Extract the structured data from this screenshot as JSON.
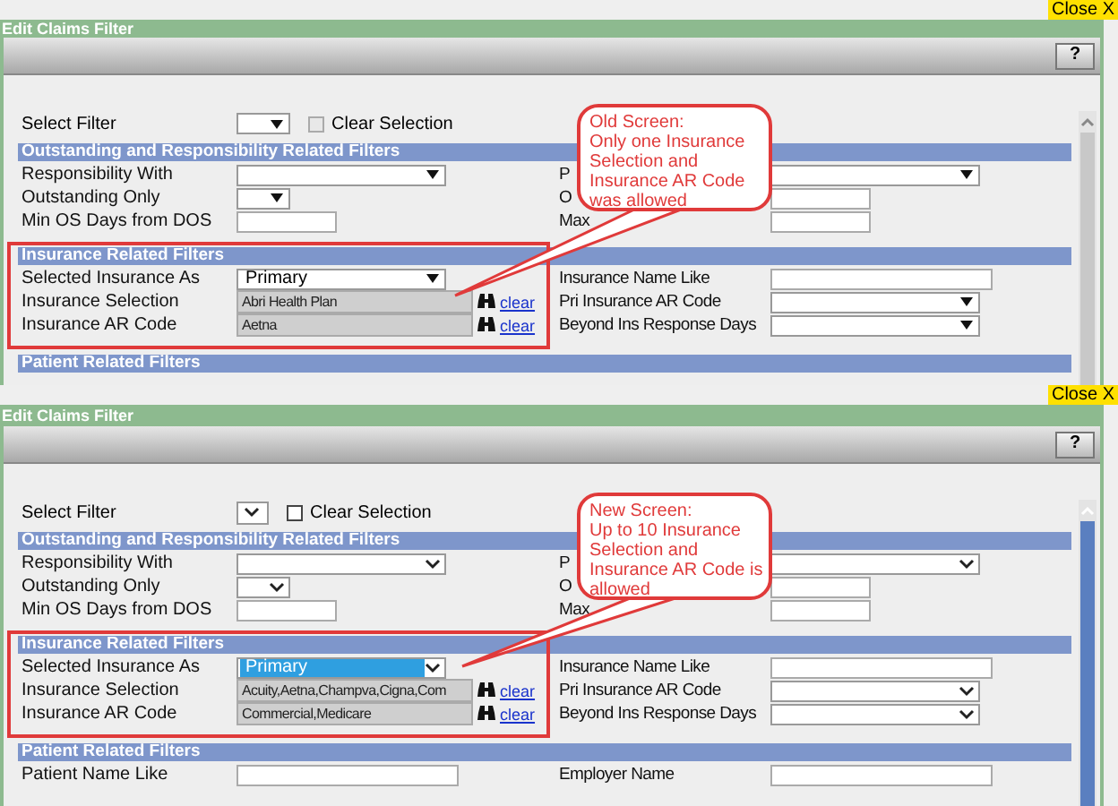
{
  "screens": [
    {
      "kind": "classic",
      "close": "Close X",
      "title": "Edit Claims Filter",
      "help": "?",
      "select_filter": {
        "label": "Select Filter",
        "checkbox": {
          "label": "Clear Selection",
          "checked": false
        }
      },
      "sections": [
        {
          "title": "Outstanding and Responsibility Related Filters",
          "rows": [
            {
              "left": {
                "label": "Responsibility With",
                "kind": "dropdown"
              },
              "right": {
                "label": "P",
                "kind": "dropdown"
              }
            },
            {
              "left": {
                "label": "Outstanding Only",
                "kind": "short-dropdown"
              },
              "right": {
                "label": "O",
                "kind": "short-input"
              }
            },
            {
              "left": {
                "label": "Min OS Days from DOS",
                "kind": "short-input"
              },
              "right": {
                "label": "Max",
                "kind": "short-input"
              }
            }
          ]
        },
        {
          "title": "Insurance Related Filters",
          "framed": true,
          "rows": [
            {
              "left": {
                "label": "Selected Insurance As",
                "kind": "dropdown",
                "value": "Primary",
                "highlighted": false
              },
              "right": {
                "label": "Insurance Name Like",
                "kind": "input"
              }
            },
            {
              "left": {
                "label": "Insurance Selection",
                "kind": "lookup",
                "value": "Abri Health Plan",
                "link": "clear"
              },
              "right": {
                "label": "Pri Insurance AR Code",
                "kind": "dropdown"
              }
            },
            {
              "left": {
                "label": "Insurance AR Code",
                "kind": "lookup",
                "value": "Aetna",
                "link": "clear"
              },
              "right": {
                "label": "Beyond Ins Response Days",
                "kind": "dropdown"
              }
            }
          ]
        },
        {
          "title": "Patient Related Filters"
        }
      ],
      "callout": {
        "lines": [
          "Old Screen:",
          "Only one Insurance",
          "Selection and",
          "Insurance AR Code",
          "was allowed"
        ]
      }
    },
    {
      "kind": "modern",
      "close": "Close X",
      "title": "Edit Claims Filter",
      "help": "?",
      "select_filter": {
        "label": "Select Filter",
        "checkbox": {
          "label": "Clear Selection",
          "checked": false
        }
      },
      "sections": [
        {
          "title": "Outstanding and Responsibility Related Filters",
          "rows": [
            {
              "left": {
                "label": "Responsibility With",
                "kind": "dropdown"
              },
              "right": {
                "label": "P",
                "kind": "dropdown"
              }
            },
            {
              "left": {
                "label": "Outstanding Only",
                "kind": "short-dropdown"
              },
              "right": {
                "label": "O",
                "kind": "short-input"
              }
            },
            {
              "left": {
                "label": "Min OS Days from DOS",
                "kind": "short-input"
              },
              "right": {
                "label": "Max",
                "kind": "short-input"
              }
            }
          ]
        },
        {
          "title": "Insurance Related Filters",
          "framed": true,
          "rows": [
            {
              "left": {
                "label": "Selected Insurance As",
                "kind": "dropdown",
                "value": "Primary",
                "highlighted": true
              },
              "right": {
                "label": "Insurance Name Like",
                "kind": "input"
              }
            },
            {
              "left": {
                "label": "Insurance Selection",
                "kind": "lookup",
                "value": "Acuity,Aetna,Champva,Cigna,Com",
                "link": "clear"
              },
              "right": {
                "label": "Pri Insurance AR Code",
                "kind": "dropdown"
              }
            },
            {
              "left": {
                "label": "Insurance AR Code",
                "kind": "lookup",
                "value": "Commercial,Medicare",
                "link": "clear"
              },
              "right": {
                "label": "Beyond Ins Response Days",
                "kind": "dropdown"
              }
            }
          ]
        },
        {
          "title": "Patient Related Filters",
          "rows": [
            {
              "left": {
                "label": "Patient Name Like",
                "kind": "input"
              },
              "right": {
                "label": "Employer Name",
                "kind": "input"
              }
            }
          ]
        }
      ],
      "callout": {
        "lines": [
          "New Screen:",
          "Up to 10 Insurance",
          "Selection and",
          "Insurance AR Code is",
          "allowed"
        ]
      }
    }
  ]
}
